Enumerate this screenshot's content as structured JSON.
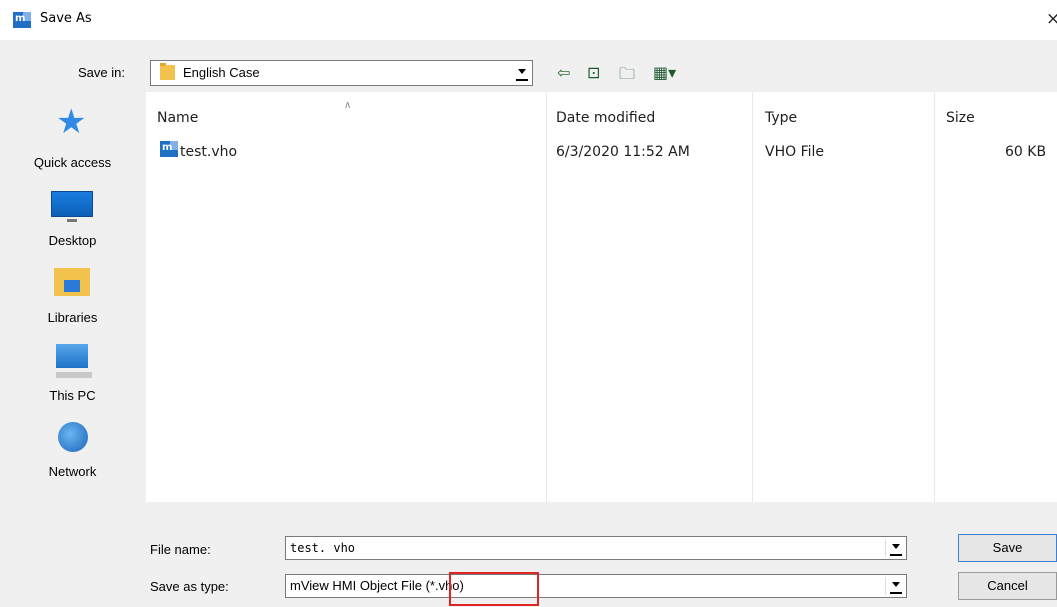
{
  "window": {
    "title": "Save As",
    "close_glyph": "×"
  },
  "save_in": {
    "label": "Save in:",
    "value": "English Case"
  },
  "toolbar": {
    "icons": [
      "back-arrow-icon",
      "up-folder-icon",
      "new-folder-icon",
      "view-menu-icon"
    ]
  },
  "places": [
    {
      "label": "Quick access",
      "icon": "quick-access-star-icon"
    },
    {
      "label": "Desktop",
      "icon": "desktop-icon"
    },
    {
      "label": "Libraries",
      "icon": "libraries-icon"
    },
    {
      "label": "This PC",
      "icon": "this-pc-icon"
    },
    {
      "label": "Network",
      "icon": "network-icon"
    }
  ],
  "file_list": {
    "columns": [
      "Name",
      "Date modified",
      "Type",
      "Size"
    ],
    "rows": [
      {
        "name": "test.vho",
        "date_modified": "6/3/2020 11:52 AM",
        "type": "VHO File",
        "size": "60 KB"
      }
    ]
  },
  "file_name": {
    "label": "File name:",
    "value": "test. vho"
  },
  "save_as_type": {
    "label": "Save as type:",
    "value": "mView HMI Object File (*.vho)"
  },
  "buttons": {
    "save": "Save",
    "cancel": "Cancel"
  },
  "colors": {
    "dialog_background": "#f0f0f0",
    "highlight": "#e02424",
    "accent": "#1f6fc5"
  }
}
